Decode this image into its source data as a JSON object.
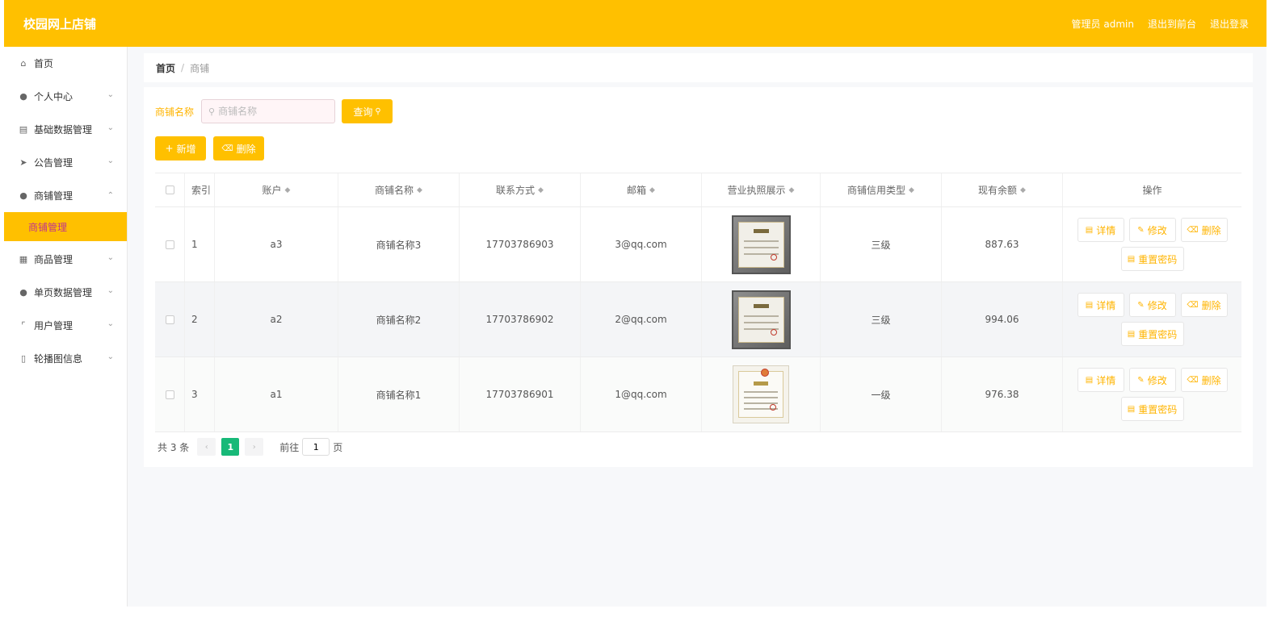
{
  "header": {
    "title": "校园网上店铺",
    "admin_label": "管理员 admin",
    "front_link": "退出到前台",
    "logout_link": "退出登录"
  },
  "sidebar": {
    "items": [
      {
        "label": "首页",
        "icon": "home-icon",
        "expanded": false,
        "has_chevron": false
      },
      {
        "label": "个人中心",
        "icon": "user-icon",
        "has_chevron": true
      },
      {
        "label": "基础数据管理",
        "icon": "briefcase-icon",
        "has_chevron": true
      },
      {
        "label": "公告管理",
        "icon": "send-icon",
        "has_chevron": true
      },
      {
        "label": "商铺管理",
        "icon": "location-icon",
        "has_chevron": true,
        "expanded": true
      },
      {
        "label": "商品管理",
        "icon": "notebook-icon",
        "has_chevron": true
      },
      {
        "label": "单页数据管理",
        "icon": "user-group-icon",
        "has_chevron": true
      },
      {
        "label": "用户管理",
        "icon": "crop-icon",
        "has_chevron": true
      },
      {
        "label": "轮播图信息",
        "icon": "phone-icon",
        "has_chevron": true
      }
    ],
    "submenu_active": "商铺管理"
  },
  "breadcrumb": {
    "home": "首页",
    "separator": "/",
    "current": "商铺"
  },
  "search": {
    "label": "商铺名称",
    "placeholder": "商铺名称",
    "value": "",
    "button": "查询"
  },
  "actions": {
    "add": "新增",
    "delete": "删除"
  },
  "table": {
    "headers": {
      "index": "索引",
      "account": "账户",
      "name": "商铺名称",
      "phone": "联系方式",
      "email": "邮箱",
      "license": "营业执照展示",
      "credit": "商铺信用类型",
      "balance": "现有余额",
      "ops": "操作"
    },
    "rows": [
      {
        "index": "1",
        "account": "a3",
        "name": "商铺名称3",
        "phone": "17703786903",
        "email": "3@qq.com",
        "credit": "三级",
        "balance": "887.63"
      },
      {
        "index": "2",
        "account": "a2",
        "name": "商铺名称2",
        "phone": "17703786902",
        "email": "2@qq.com",
        "credit": "三级",
        "balance": "994.06"
      },
      {
        "index": "3",
        "account": "a1",
        "name": "商铺名称1",
        "phone": "17703786901",
        "email": "1@qq.com",
        "credit": "一级",
        "balance": "976.38"
      }
    ],
    "row_ops": {
      "detail": "详情",
      "edit": "修改",
      "delete": "删除",
      "reset": "重置密码"
    }
  },
  "pagination": {
    "total": "共 3 条",
    "current": "1",
    "goto_label": "前往",
    "goto_value": "1",
    "page_unit": "页"
  },
  "colors": {
    "accent": "#ffc000",
    "page_active": "#17b978",
    "link_pink": "#c0358e"
  }
}
